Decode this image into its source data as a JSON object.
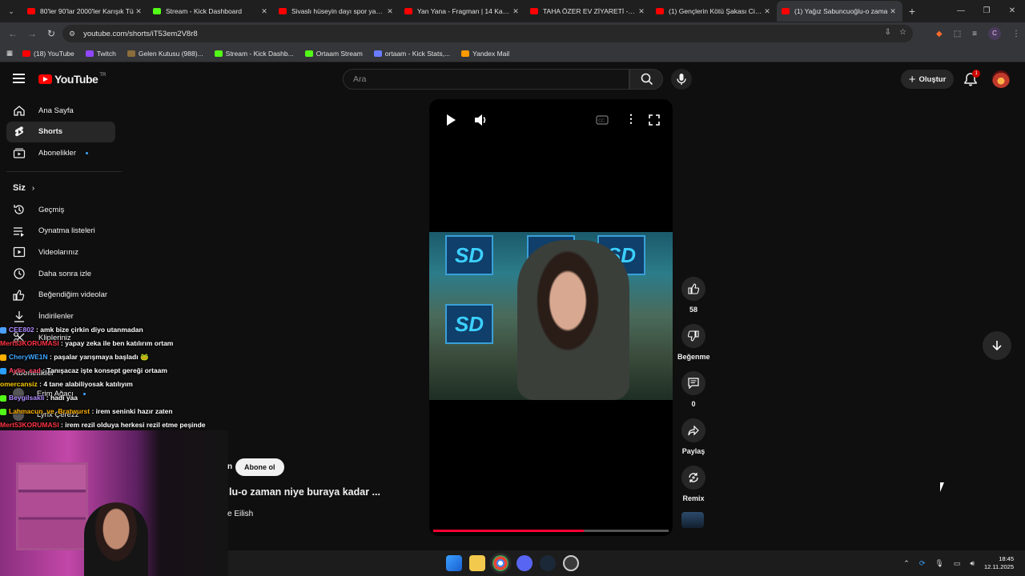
{
  "browser": {
    "tabs": [
      {
        "label": "80'ler 90'lar 2000'ler Karışık Tü",
        "favicon": "youtube",
        "active": false
      },
      {
        "label": "Stream - Kick Dashboard",
        "favicon": "kick",
        "active": false
      },
      {
        "label": "Sivaslı hüseyin dayı spor yapıyo",
        "favicon": "youtube",
        "active": false
      },
      {
        "label": "Yan Yana - Fragman | 14 Kasım",
        "favicon": "youtube",
        "active": false
      },
      {
        "label": "TAHA ÖZER EV ZİYARETİ - YouT",
        "favicon": "youtube",
        "active": false
      },
      {
        "label": "(1) Gençlerin Kötü Şakası Cinay",
        "favicon": "youtube",
        "active": false
      },
      {
        "label": "(1) Yağız Sabuncuoğlu-o zama",
        "favicon": "youtube",
        "active": true
      }
    ],
    "url": "youtube.com/shorts/iT53em2V8r8",
    "bookmarks": [
      {
        "label": "(18) YouTube",
        "color": "#ff0000"
      },
      {
        "label": "Twitch",
        "color": "#9146ff"
      },
      {
        "label": "Gelen Kutusu (988)...",
        "color": "#8a6d3b"
      },
      {
        "label": "Stream - Kick Dashb...",
        "color": "#53fc18"
      },
      {
        "label": "Ortaam Stream",
        "color": "#53fc18"
      },
      {
        "label": "ortaam - Kick Stats,...",
        "color": "#6a7cff"
      },
      {
        "label": "Yandex Mail",
        "color": "#ff9a00"
      }
    ],
    "profile_initial": "C"
  },
  "header": {
    "logo_text": "YouTube",
    "logo_suffix": "TR",
    "search_placeholder": "Ara",
    "create_label": "Oluştur",
    "notification_count": "1"
  },
  "sidebar": {
    "items_top": [
      {
        "label": "Ana Sayfa",
        "icon": "home-icon"
      },
      {
        "label": "Shorts",
        "icon": "shorts-icon",
        "active": true
      },
      {
        "label": "Abonelikler",
        "icon": "subscriptions-icon",
        "dot": true
      }
    ],
    "you_heading": "Siz",
    "items_you": [
      {
        "label": "Geçmiş",
        "icon": "history-icon"
      },
      {
        "label": "Oynatma listeleri",
        "icon": "playlist-icon"
      },
      {
        "label": "Videolarınız",
        "icon": "your-videos-icon"
      },
      {
        "label": "Daha sonra izle",
        "icon": "watch-later-icon"
      },
      {
        "label": "Beğendiğim videolar",
        "icon": "liked-icon"
      },
      {
        "label": "İndirilenler",
        "icon": "download-icon"
      },
      {
        "label": "Klipleriniz",
        "icon": "clips-icon"
      }
    ],
    "subscriptions_heading": "Abonelikler",
    "subscriptions": [
      {
        "label": "Erim Ağacı",
        "dot": true
      },
      {
        "label": "Lynx Çerezz"
      }
    ]
  },
  "chat": [
    {
      "user": "CEE802",
      "color": "#b18cff",
      "badge": "#4aa0ff",
      "text": "amk bize çirkin diyo utanmadan"
    },
    {
      "user": "Mert53KORUMASI",
      "color": "#ff3344",
      "badge": "",
      "text": "yapay zeka ile ben katılırım ortam"
    },
    {
      "user": "CheryWE1N",
      "color": "#3ea6ff",
      "badge": "#ffb000",
      "text": "paşalar yarışmaya başladı 🐸"
    },
    {
      "user": "Aylin_sad",
      "color": "#ff4466",
      "badge": "#2aa0ff",
      "text": "Tanışacaz işte konsept gereği ortaam"
    },
    {
      "user": "omercansiz",
      "color": "#ffcc00",
      "badge": "",
      "text": "4 tane alabiliyosak katılıyım"
    },
    {
      "user": "Beygilsakli",
      "color": "#b18cff",
      "badge": "#53fc18",
      "text": "hadi yaa"
    },
    {
      "user": "Lahmacun_ve_Bratwurst",
      "color": "#ffb000",
      "badge": "#53fc18",
      "text": "irem seninki hazır zaten"
    },
    {
      "user": "Mert53KORUMASI",
      "color": "#ff3344",
      "badge": "",
      "text": "irem rezil olduya herkesi rezil etme peşinde"
    }
  ],
  "player": {
    "overlay_text": "SD",
    "progress": 0.64
  },
  "actions": {
    "like_count": "58",
    "dislike_label": "Beğenme",
    "comment_count": "0",
    "share_label": "Paylaş",
    "remix_label": "Remix"
  },
  "meta": {
    "channel_fragment": "n",
    "subscribe_label": "Abone ol",
    "title_fragment": "lu-o zaman niye buraya kadar ...",
    "audio_fragment": "e Eilish"
  },
  "taskbar": {
    "time": "18:45",
    "date": "12.11.2025"
  }
}
